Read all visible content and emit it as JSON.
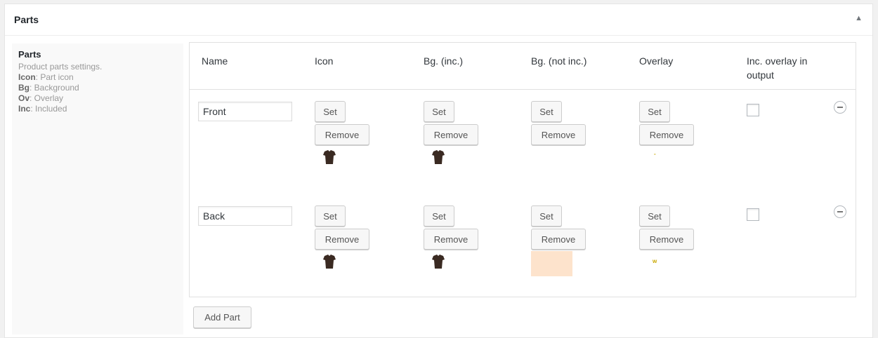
{
  "postbox": {
    "title": "Parts",
    "toggle_icon": "triangle-up-icon"
  },
  "sidebar": {
    "title": "Parts",
    "subtitle": "Product parts settings.",
    "legend": [
      {
        "key": "Icon",
        "desc": ": Part icon"
      },
      {
        "key": "Bg",
        "desc": ": Background"
      },
      {
        "key": "Ov",
        "desc": ": Overlay"
      },
      {
        "key": "Inc",
        "desc": ": Included"
      }
    ]
  },
  "table": {
    "headers": {
      "name": "Name",
      "icon": "Icon",
      "bg_inc": "Bg. (inc.)",
      "bg_not_inc": "Bg. (not inc.)",
      "overlay": "Overlay",
      "inc_overlay": "Inc. overlay in",
      "inc_overlay_2": "output"
    },
    "rows": [
      {
        "name": "Front",
        "set_label": "Set",
        "remove_label": "Remove",
        "icon_image": "tshirt-icon",
        "bg_inc_image": "tshirt-icon",
        "bg_not_inc_image": "",
        "overlay_mark": "-",
        "inc_overlay_checked": false
      },
      {
        "name": "Back",
        "set_label": "Set",
        "remove_label": "Remove",
        "icon_image": "tshirt-icon",
        "bg_inc_image": "tshirt-icon",
        "bg_not_inc_color": "#fde3cc",
        "overlay_mark": "w",
        "inc_overlay_checked": false
      }
    ]
  },
  "add_part_label": "Add Part",
  "colors": {
    "shirt": "#3a2a22",
    "swatch": "#fde3cc",
    "overlay_mark": "#caa800"
  }
}
